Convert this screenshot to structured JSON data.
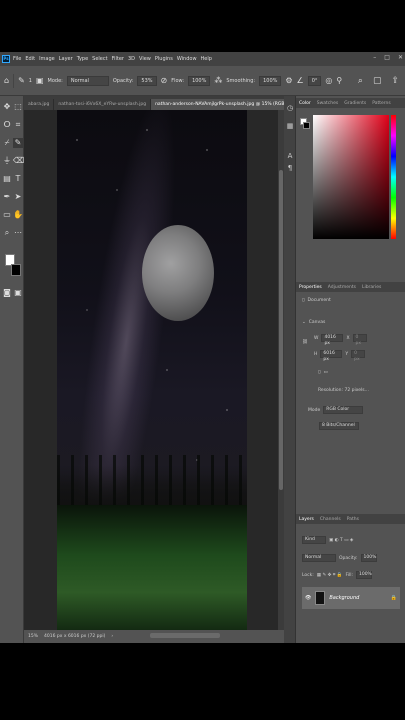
{
  "menu": {
    "logo": "Ps",
    "items": [
      "File",
      "Edit",
      "Image",
      "Layer",
      "Type",
      "Select",
      "Filter",
      "3D",
      "View",
      "Plugins",
      "Window",
      "Help"
    ]
  },
  "window_controls": [
    "–",
    "□",
    "✕"
  ],
  "options": {
    "mode_label": "Mode:",
    "mode_value": "Normal",
    "opacity_label": "Opacity:",
    "opacity_value": "53%",
    "flow_label": "Flow:",
    "flow_value": "100%",
    "smoothing_label": "Smoothing:",
    "smoothing_value": "100%",
    "angle_value": "0°",
    "brush_size": "1"
  },
  "tabs": [
    {
      "label": "abara.jpg"
    },
    {
      "label": "nathan-tosi-i6Vx6X_eYRw-unsplash.jpg"
    },
    {
      "label": "nathan-anderson-NAVAmjlgrPk-unsplash.jpg @ 15% (RGB/8) *",
      "active": true
    }
  ],
  "status": {
    "zoom": "15%",
    "doc_info": "4016 px x 6016 px (72 ppi)"
  },
  "color_panel": {
    "tabs": [
      "Color",
      "Swatches",
      "Gradients",
      "Patterns"
    ],
    "accent": "#e00018"
  },
  "properties": {
    "tabs": [
      "Properties",
      "Adjustments",
      "Libraries"
    ],
    "section_doc": "Document",
    "section_canvas": "Canvas",
    "width": "4016 px",
    "width_axis": "X",
    "width_x": "0 px",
    "height": "6016 px",
    "height_axis": "Y",
    "height_y": "0 px",
    "resolution": "Resolution: 72 pixels...",
    "mode_label": "Mode",
    "mode_value": "RGB Color",
    "bits_value": "8 Bits/Channel"
  },
  "layers": {
    "tabs": [
      "Layers",
      "Channels",
      "Paths"
    ],
    "kind_label": "Kind",
    "blend_value": "Normal",
    "opacity_label": "Opacity:",
    "opacity_value": "100%",
    "lock_label": "Lock:",
    "fill_label": "Fill:",
    "fill_value": "100%",
    "layer_name": "Background"
  }
}
